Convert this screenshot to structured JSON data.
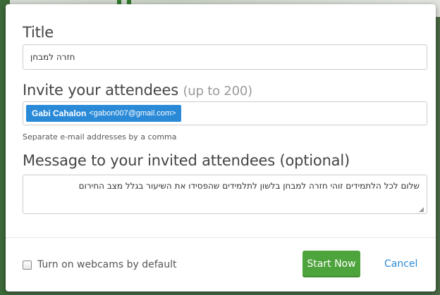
{
  "dialog": {
    "title_label": "Title",
    "title_value": "חזרה למבחן",
    "invite_label": "Invite your attendees",
    "invite_hint": "(up to 200)",
    "attendee": {
      "name": "Gabi Cahalon",
      "email": "<gabon007@gmail.com>"
    },
    "invite_help": "Separate e-mail addresses by a comma",
    "message_label": "Message to your invited attendees (optional)",
    "message_value": "שלום לכל הלתמידים זוהי חזרה למבחן בלשון לתלמידים שהפסידו את השיעור בגלל מצב החירום",
    "webcam_label": "Turn on webcams by default",
    "start_label": "Start Now",
    "cancel_label": "Cancel"
  },
  "colors": {
    "accent_blue": "#2a8ad8",
    "start_green": "#4ea43c"
  }
}
